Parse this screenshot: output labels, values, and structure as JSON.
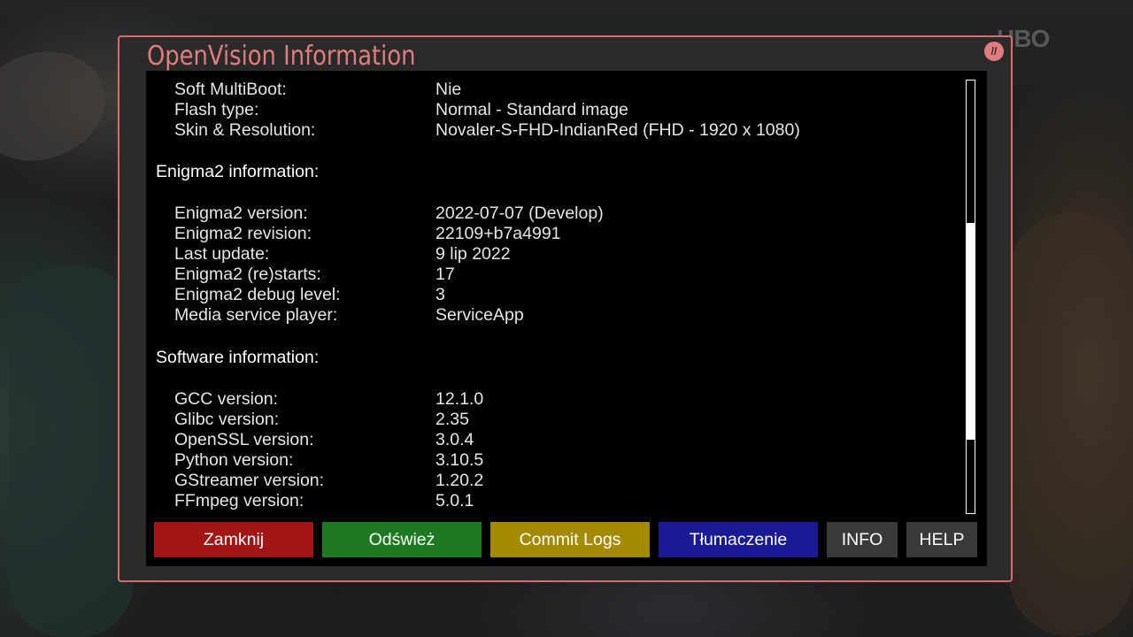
{
  "window": {
    "title": "OpenVision Information",
    "accent_color": "#e37c7c"
  },
  "background": {
    "channel_logo": "HBO"
  },
  "info": {
    "rows_top": [
      {
        "key": "Soft MultiBoot:",
        "value": "Nie"
      },
      {
        "key": "Flash type:",
        "value": "Normal - Standard image"
      },
      {
        "key": "Skin & Resolution:",
        "value": "Novaler-S-FHD-IndianRed  (FHD  -  1920 x 1080)"
      }
    ],
    "section_enigma": "Enigma2 information:",
    "rows_enigma": [
      {
        "key": "Enigma2 version:",
        "value": "2022-07-07 (Develop)"
      },
      {
        "key": "Enigma2 revision:",
        "value": "22109+b7a4991"
      },
      {
        "key": "Last update:",
        "value": "9 lip 2022"
      },
      {
        "key": "Enigma2 (re)starts:",
        "value": "17"
      },
      {
        "key": "Enigma2 debug level:",
        "value": "3"
      },
      {
        "key": "Media service player:",
        "value": "ServiceApp"
      }
    ],
    "section_software": "Software information:",
    "rows_software": [
      {
        "key": "GCC version:",
        "value": "12.1.0"
      },
      {
        "key": "Glibc version:",
        "value": "2.35"
      },
      {
        "key": "OpenSSL version:",
        "value": "3.0.4"
      },
      {
        "key": "Python version:",
        "value": "3.10.5"
      },
      {
        "key": "GStreamer version:",
        "value": "1.20.2"
      },
      {
        "key": "FFmpeg version:",
        "value": "5.0.1"
      }
    ]
  },
  "scroll": {
    "visible_fraction": 0.5,
    "position_fraction": 0.33
  },
  "buttons": {
    "red": "Zamknij",
    "green": "Odśwież",
    "yellow": "Commit Logs",
    "blue": "Tłumaczenie",
    "info": "INFO",
    "help": "HELP"
  },
  "colors": {
    "red": "#a31616",
    "green": "#1d7a20",
    "yellow": "#a38a00",
    "blue": "#1a1a96",
    "border": "#d66e6e"
  }
}
